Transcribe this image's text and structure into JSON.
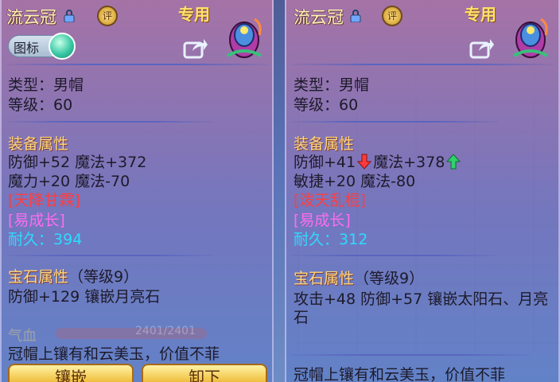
{
  "left": {
    "title": "流云冠",
    "ping_badge": "评",
    "exclusive": "专用",
    "icon_toggle_label": "图标",
    "type": "类型：男帽",
    "level": "等级：60",
    "attr_section": "装备属性",
    "attr_line1": "防御+52 魔法+372",
    "attr_line2": "魔力+20 魔法-70",
    "special_tag": "[天降甘霖]",
    "growth_tag": "[易成长]",
    "durability_label": "耐久：",
    "durability_value": "394",
    "gem_section": "宝石属性",
    "gem_level": "（等级9）",
    "gem_line": "防御+129 镶嵌月亮石",
    "hp_label": "气血",
    "hp_value": "2401/2401",
    "description": "冠帽上镶有和云美玉，价值不菲",
    "btn_inlay": "镶嵌",
    "btn_remove": "卸下"
  },
  "right": {
    "title": "流云冠",
    "ping_badge": "评",
    "exclusive": "专用",
    "type": "类型：男帽",
    "level": "等级：60",
    "attr_section": "装备属性",
    "attr_line1_a": "防御+41",
    "attr_line1_b": "魔法+378",
    "attr_line2": "敏捷+20 魔法-80",
    "special_tag": "[泼天乱棍]",
    "growth_tag": "[易成长]",
    "durability_label": "耐久：",
    "durability_value": "312",
    "gem_section": "宝石属性",
    "gem_level": "（等级9）",
    "gem_line1": "攻击+48 防御+57 镶嵌太阳石、月亮",
    "gem_line2": "石",
    "description": "冠帽上镶有和云美玉，价值不菲"
  },
  "colors": {
    "section": "#ffd67a",
    "special": "#ff3d3d",
    "growth": "#ff6cf0",
    "durability": "#2cdcff",
    "arrow_down": "#ff3b3b",
    "arrow_up": "#2fd36b"
  },
  "icons": {
    "lock": "lock-icon",
    "share": "share-icon",
    "item": "hat-item-icon",
    "down": "arrow-down-icon",
    "up": "arrow-up-icon"
  }
}
